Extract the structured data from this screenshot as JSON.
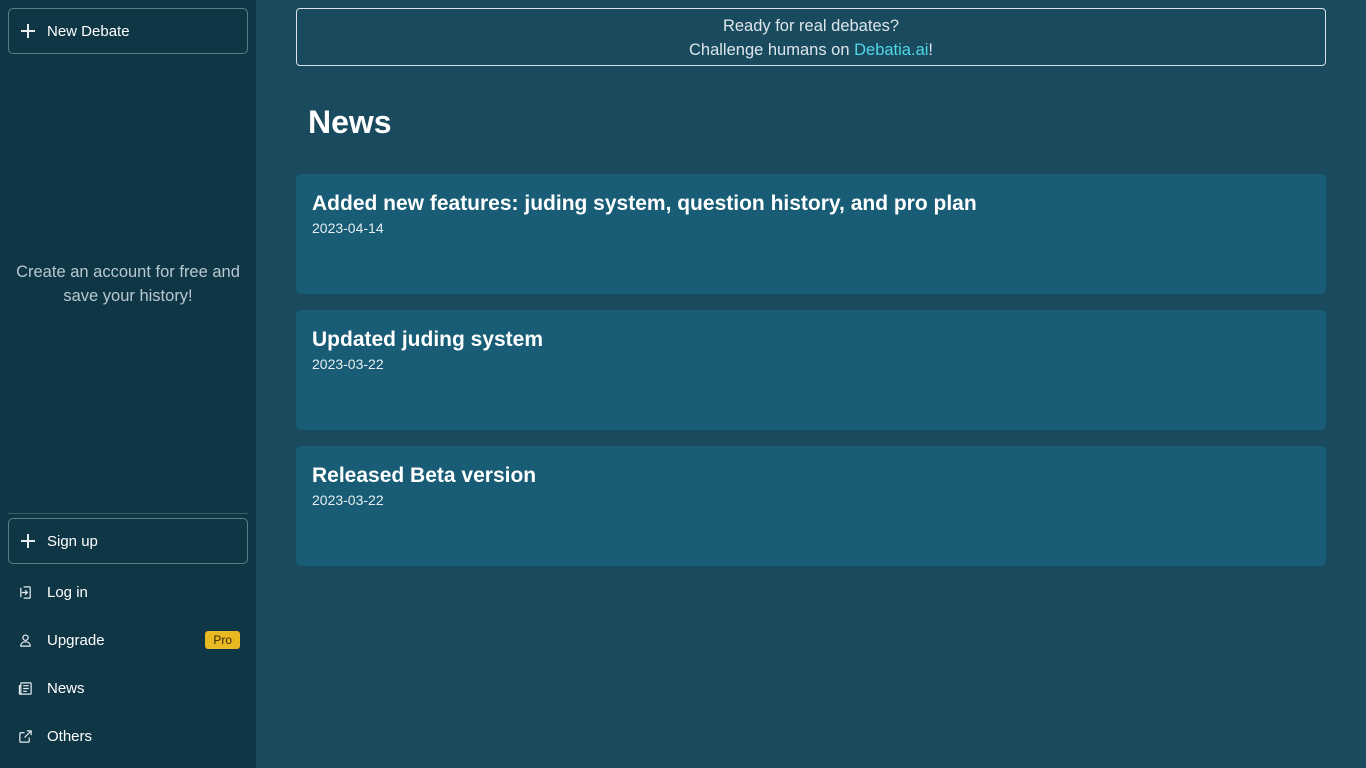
{
  "sidebar": {
    "new_debate_label": "New Debate",
    "promo_text": "Create an account for free and save your history!",
    "signup_label": "Sign up",
    "items": [
      {
        "label": "Log in",
        "icon": "login-icon"
      },
      {
        "label": "Upgrade",
        "icon": "user-icon",
        "badge": "Pro"
      },
      {
        "label": "News",
        "icon": "newspaper-icon"
      },
      {
        "label": "Others",
        "icon": "external-link-icon"
      }
    ]
  },
  "banner": {
    "line1": "Ready for real debates?",
    "line2_prefix": "Challenge humans on ",
    "link_text": "Debatia.ai",
    "line2_suffix": "!"
  },
  "main": {
    "title": "News",
    "news": [
      {
        "title": "Added new features: juding system, question history, and pro plan",
        "date": "2023-04-14"
      },
      {
        "title": "Updated juding system",
        "date": "2023-03-22"
      },
      {
        "title": "Released Beta version",
        "date": "2023-03-22"
      }
    ]
  },
  "colors": {
    "sidebar_bg": "#0f3645",
    "main_bg": "#1a4a5e",
    "card_bg": "#185c75",
    "link": "#4fd8e8",
    "pro_badge": "#e8b923"
  }
}
